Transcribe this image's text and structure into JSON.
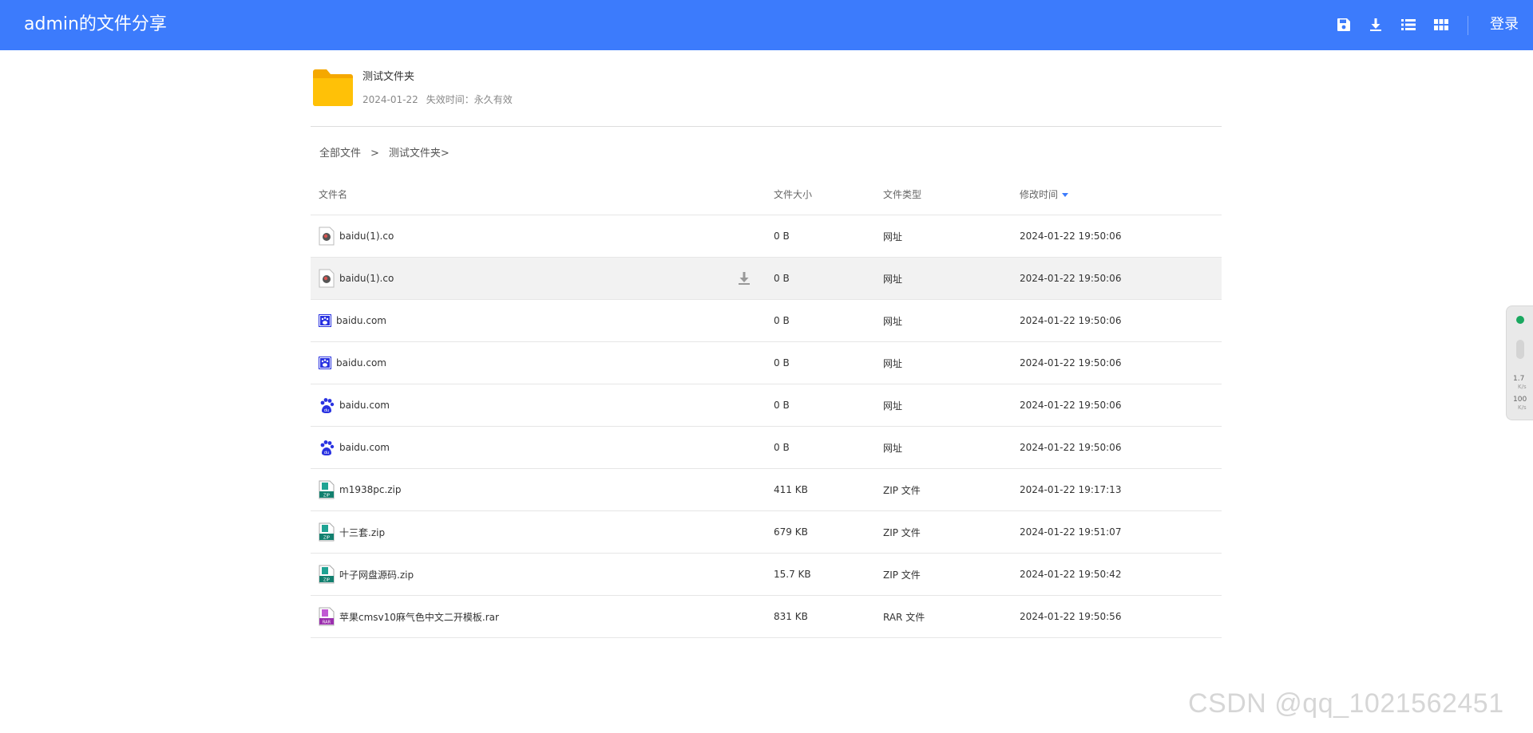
{
  "header": {
    "title": "admin的文件分享",
    "toolbar": [
      {
        "name": "save-icon",
        "label": "save"
      },
      {
        "name": "download-icon",
        "label": "download"
      },
      {
        "name": "list-view-icon",
        "label": "list view"
      },
      {
        "name": "grid-view-icon",
        "label": "grid view"
      }
    ],
    "login_label": "登录",
    "colors": {
      "bar": "#3c7bfc",
      "text": "#ffffff"
    }
  },
  "share": {
    "folder_name": "测试文件夹",
    "date": "2024-01-22",
    "expiry_label": "失效时间：",
    "expiry_value": "永久有效"
  },
  "breadcrumb": {
    "root": "全部文件",
    "separator": ">",
    "current": "测试文件夹>"
  },
  "table": {
    "columns": {
      "name": "文件名",
      "size": "文件大小",
      "type": "文件类型",
      "time": "修改时间"
    },
    "sort": {
      "column": "time",
      "direction": "desc"
    },
    "rows": [
      {
        "name": "baidu(1).co",
        "size": "0 B",
        "type": "网址",
        "time": "2024-01-22 19:50:06",
        "icon": "web-link-icon"
      },
      {
        "name": "baidu(1).co",
        "size": "0 B",
        "type": "网址",
        "time": "2024-01-22 19:50:06",
        "icon": "web-link-icon"
      },
      {
        "name": "baidu.com",
        "size": "0 B",
        "type": "网址",
        "time": "2024-01-22 19:50:06",
        "icon": "baidu-small-icon"
      },
      {
        "name": "baidu.com",
        "size": "0 B",
        "type": "网址",
        "time": "2024-01-22 19:50:06",
        "icon": "baidu-small-icon"
      },
      {
        "name": "baidu.com",
        "size": "0 B",
        "type": "网址",
        "time": "2024-01-22 19:50:06",
        "icon": "baidu-paw-icon"
      },
      {
        "name": "baidu.com",
        "size": "0 B",
        "type": "网址",
        "time": "2024-01-22 19:50:06",
        "icon": "baidu-paw-icon"
      },
      {
        "name": "m1938pc.zip",
        "size": "411 KB",
        "type": "ZIP 文件",
        "time": "2024-01-22 19:17:13",
        "icon": "zip-file-icon"
      },
      {
        "name": "十三套.zip",
        "size": "679 KB",
        "type": "ZIP 文件",
        "time": "2024-01-22 19:51:07",
        "icon": "zip-file-icon"
      },
      {
        "name": "叶子网盘源码.zip",
        "size": "15.7 KB",
        "type": "ZIP 文件",
        "time": "2024-01-22 19:50:42",
        "icon": "zip-file-icon"
      },
      {
        "name": "苹果cmsv10麻气色中文二开模板.rar",
        "size": "831 KB",
        "type": "RAR 文件",
        "time": "2024-01-22 19:50:56",
        "icon": "rar-file-icon"
      }
    ],
    "hovered_row_index": 1
  },
  "side_widget": {
    "upload_speed": "1.7",
    "upload_unit": "K/s",
    "download_speed": "100",
    "download_unit": "K/s"
  },
  "watermark": "CSDN @qq_1021562451"
}
